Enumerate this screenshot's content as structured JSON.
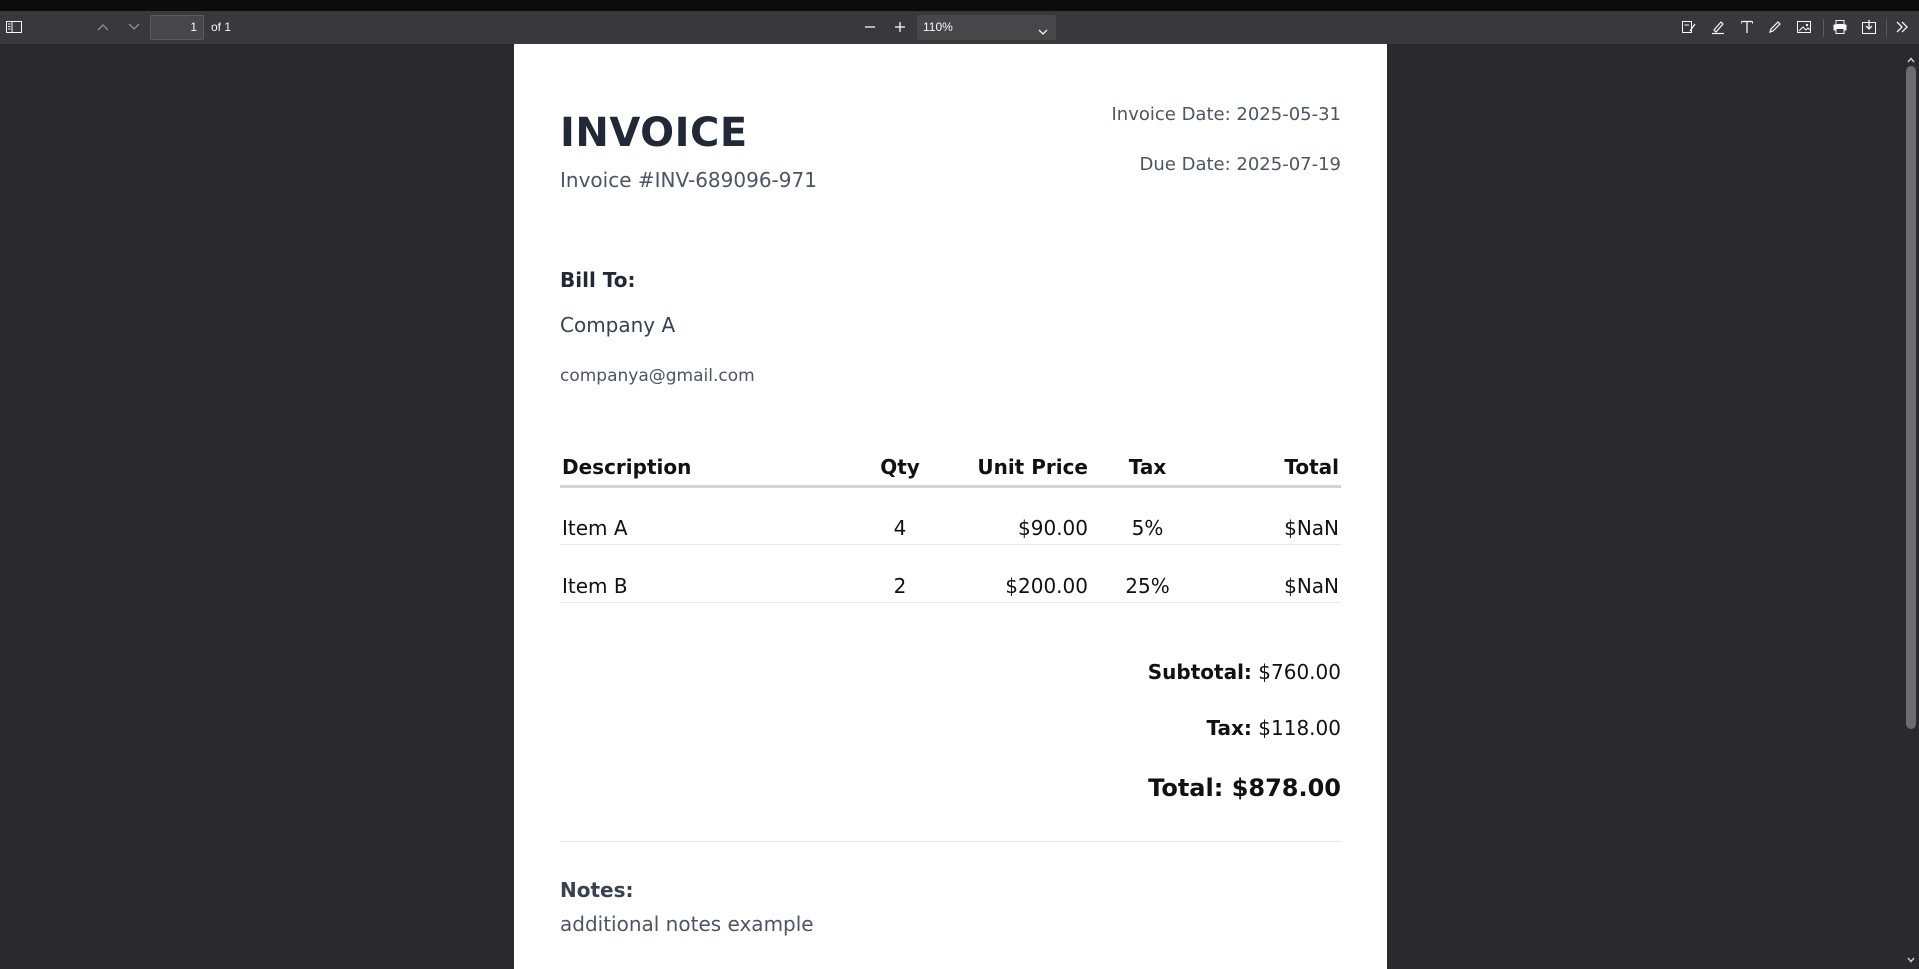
{
  "toolbar": {
    "page_number": "1",
    "page_of": "of 1",
    "zoom_value": "110%"
  },
  "invoice": {
    "title": "INVOICE",
    "number": "Invoice #INV-689096-971",
    "invoice_date": "Invoice Date: 2025-05-31",
    "due_date": "Due Date: 2025-07-19",
    "bill_to_label": "Bill To:",
    "company": "Company A",
    "email": "companya@gmail.com",
    "table": {
      "headers": [
        "Description",
        "Qty",
        "Unit Price",
        "Tax",
        "Total"
      ],
      "rows": [
        [
          "Item A",
          "4",
          "$90.00",
          "5%",
          "$NaN"
        ],
        [
          "Item B",
          "2",
          "$200.00",
          "25%",
          "$NaN"
        ]
      ]
    },
    "subtotal_label": "Subtotal:",
    "subtotal_value": "$760.00",
    "tax_label": "Tax:",
    "tax_value": "$118.00",
    "total_label": "Total:",
    "total_value": "$878.00",
    "notes_label": "Notes:",
    "notes_text": "additional notes example"
  }
}
